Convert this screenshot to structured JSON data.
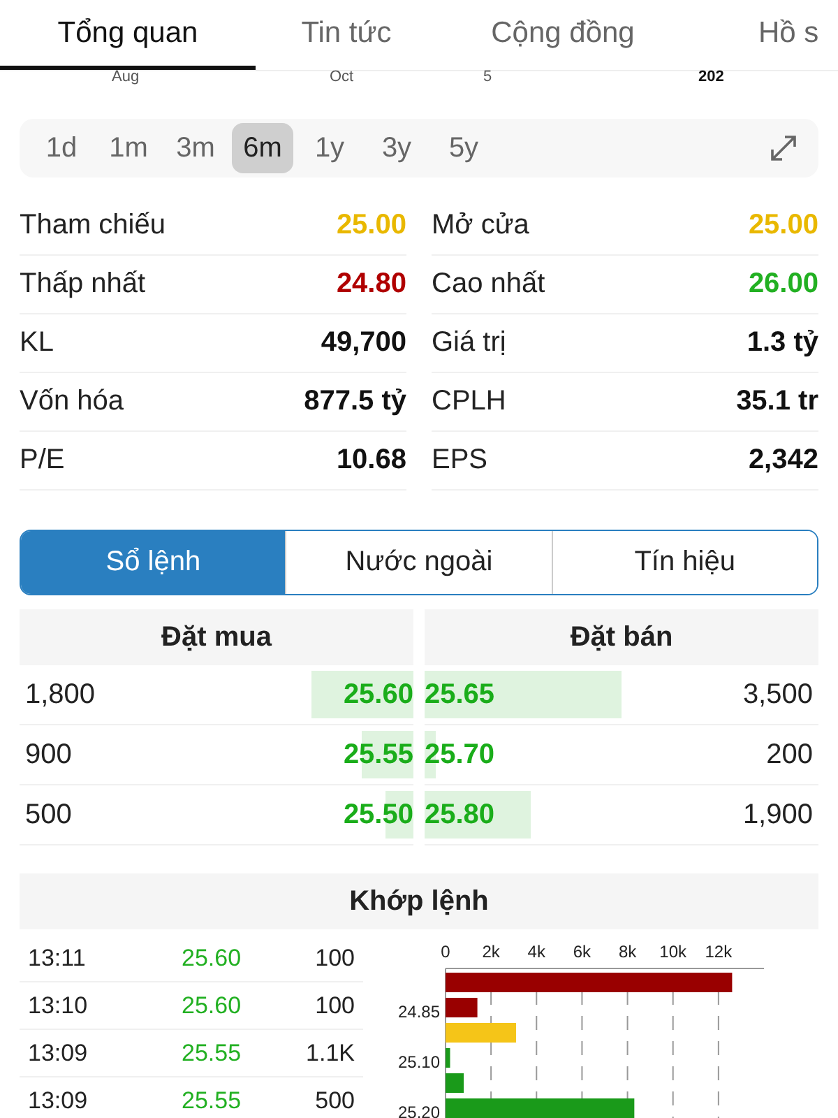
{
  "tabs": [
    {
      "label": "Tổng quan",
      "selected": true
    },
    {
      "label": "Tin tức",
      "selected": false
    },
    {
      "label": "Cộng đồng",
      "selected": false
    },
    {
      "label": "Hồ s",
      "selected": false
    }
  ],
  "chart_axis_labels": [
    "Aug",
    "Oct",
    "5",
    "202"
  ],
  "periods": [
    {
      "label": "1d",
      "selected": false
    },
    {
      "label": "1m",
      "selected": false
    },
    {
      "label": "3m",
      "selected": false
    },
    {
      "label": "6m",
      "selected": true
    },
    {
      "label": "1y",
      "selected": false
    },
    {
      "label": "3y",
      "selected": false
    },
    {
      "label": "5y",
      "selected": false
    }
  ],
  "stats": [
    [
      {
        "label": "Tham chiếu",
        "value": "25.00",
        "kind": "reference"
      },
      {
        "label": "Mở cửa",
        "value": "25.00",
        "kind": "reference"
      }
    ],
    [
      {
        "label": "Thấp nhất",
        "value": "24.80",
        "kind": "down"
      },
      {
        "label": "Cao nhất",
        "value": "26.00",
        "kind": "up"
      }
    ],
    [
      {
        "label": "KL",
        "value": "49,700",
        "kind": "plain"
      },
      {
        "label": "Giá trị",
        "value": "1.3 tỷ",
        "kind": "plain"
      }
    ],
    [
      {
        "label": "Vốn hóa",
        "value": "877.5 tỷ",
        "kind": "plain"
      },
      {
        "label": "CPLH",
        "value": "35.1 tr",
        "kind": "plain"
      }
    ],
    [
      {
        "label": "P/E",
        "value": "10.68",
        "kind": "plain"
      },
      {
        "label": "EPS",
        "value": "2,342",
        "kind": "plain"
      }
    ]
  ],
  "segments": [
    {
      "label": "Sổ lệnh",
      "selected": true
    },
    {
      "label": "Nước ngoài",
      "selected": false
    },
    {
      "label": "Tín hiệu",
      "selected": false
    }
  ],
  "order_book": {
    "buy_title": "Đặt mua",
    "sell_title": "Đặt bán",
    "rows": [
      {
        "buy": {
          "volume": "1,800",
          "price": "25.60",
          "level": 0.26
        },
        "sell": {
          "price": "25.65",
          "level": 0.5,
          "volume": "3,500"
        }
      },
      {
        "buy": {
          "volume": "900",
          "price": "25.55",
          "level": 0.13
        },
        "sell": {
          "price": "25.70",
          "level": 0.03,
          "volume": "200"
        }
      },
      {
        "buy": {
          "volume": "500",
          "price": "25.50",
          "level": 0.07
        },
        "sell": {
          "price": "25.80",
          "level": 0.27,
          "volume": "1,900"
        }
      }
    ]
  },
  "matched": {
    "title": "Khớp lệnh",
    "rows": [
      {
        "time": "13:11",
        "price": "25.60",
        "volume": "100"
      },
      {
        "time": "13:10",
        "price": "25.60",
        "volume": "100"
      },
      {
        "time": "13:09",
        "price": "25.55",
        "volume": "1.1K"
      },
      {
        "time": "13:09",
        "price": "25.55",
        "volume": "500"
      }
    ],
    "chart_data": {
      "type": "bar",
      "orientation": "horizontal",
      "categories": [
        null,
        "24.85",
        null,
        "25.10",
        null,
        "25.20"
      ],
      "grid": true,
      "xlim": [
        0,
        14000
      ],
      "xticks": [
        {
          "value": 0,
          "label": "0"
        },
        {
          "value": 2000,
          "label": "2k"
        },
        {
          "value": 4000,
          "label": "4k"
        },
        {
          "value": 6000,
          "label": "6k"
        },
        {
          "value": 8000,
          "label": "8k"
        },
        {
          "value": 10000,
          "label": "10k"
        },
        {
          "value": 12000,
          "label": "12k"
        }
      ],
      "values": [
        12600,
        1400,
        3100,
        200,
        800,
        8300
      ],
      "colors": [
        "#990000",
        "#990000",
        "#f5c518",
        "#1a9a1a",
        "#1a9a1a",
        "#1a9a1a"
      ]
    }
  }
}
